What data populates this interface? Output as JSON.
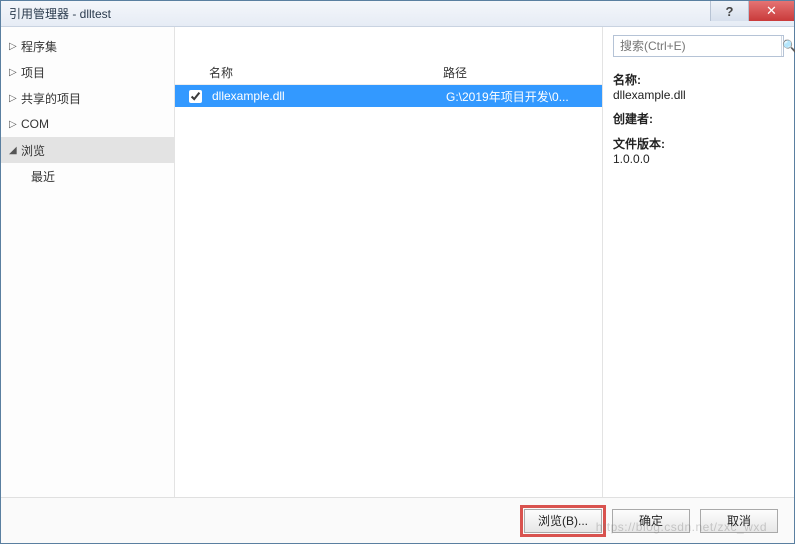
{
  "window": {
    "title": "引用管理器 - dlltest"
  },
  "sidebar": {
    "items": [
      {
        "label": "程序集",
        "expandable": true,
        "selected": false
      },
      {
        "label": "项目",
        "expandable": true,
        "selected": false
      },
      {
        "label": "共享的项目",
        "expandable": true,
        "selected": false
      },
      {
        "label": "COM",
        "expandable": true,
        "selected": false
      },
      {
        "label": "浏览",
        "expandable": true,
        "selected": true
      },
      {
        "label": "最近",
        "expandable": false,
        "child": true,
        "selected": false
      }
    ]
  },
  "columns": {
    "name": "名称",
    "path": "路径"
  },
  "rows": [
    {
      "checked": true,
      "name": "dllexample.dll",
      "path": "G:\\2019年项目开发\\0..."
    }
  ],
  "search": {
    "placeholder": "搜索(Ctrl+E)"
  },
  "detail": {
    "name_label": "名称:",
    "name_value": "dllexample.dll",
    "creator_label": "创建者:",
    "creator_value": "",
    "version_label": "文件版本:",
    "version_value": "1.0.0.0"
  },
  "footer": {
    "browse": "浏览(B)...",
    "ok": "确定",
    "cancel": "取消"
  },
  "watermark": "https://blog.csdn.net/zxc_wxd"
}
